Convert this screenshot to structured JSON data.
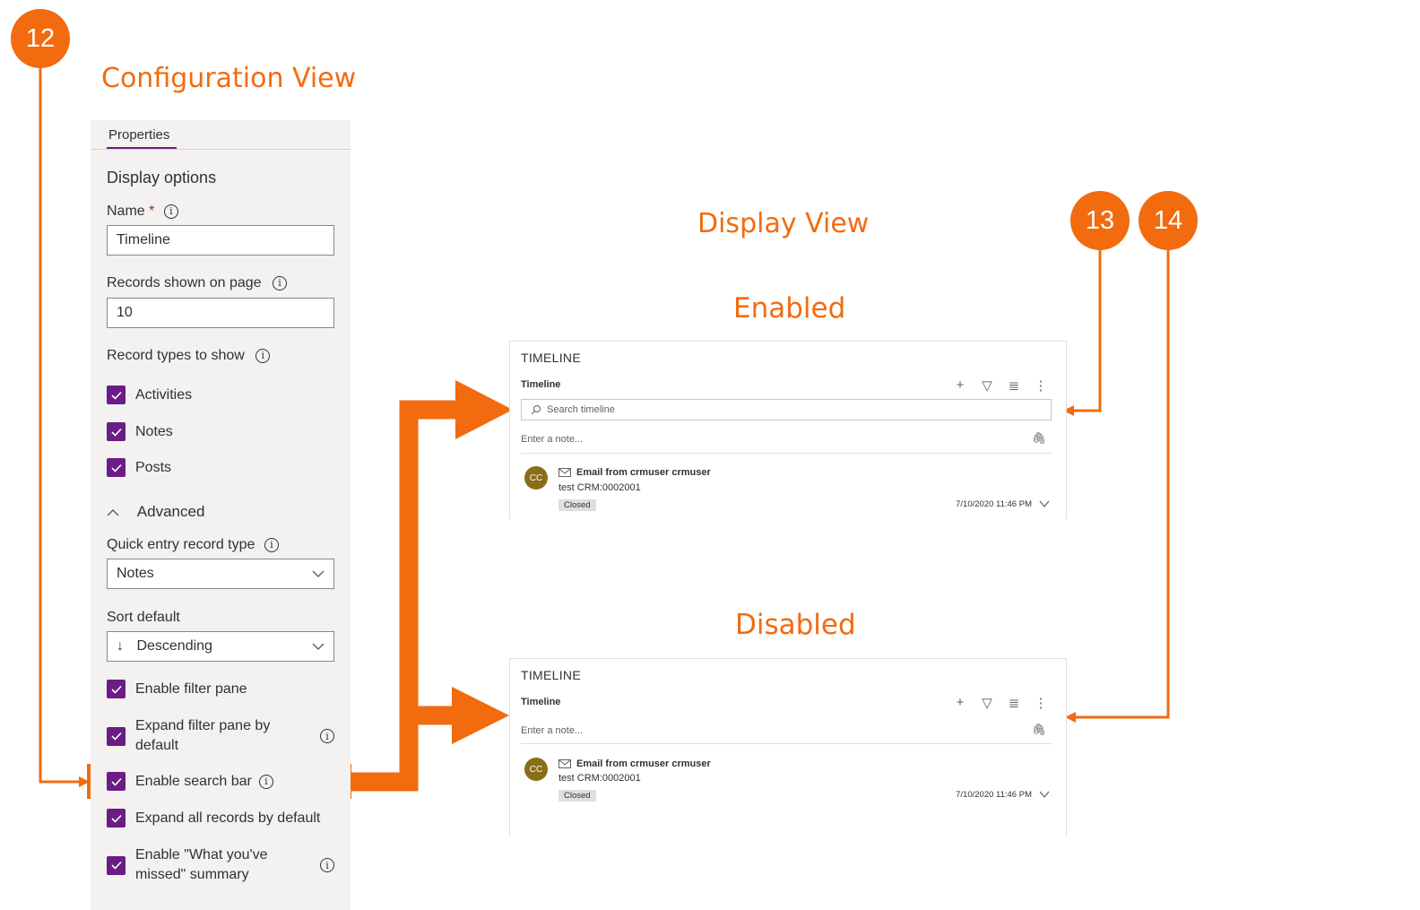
{
  "annotations": {
    "badge_12": "12",
    "badge_13": "13",
    "badge_14": "14",
    "configuration_title": "Configuration View",
    "display_title": "Display View",
    "enabled_title": "Enabled",
    "disabled_title": "Disabled",
    "accent_color": "#f26b0f"
  },
  "properties_panel": {
    "tab": "Properties",
    "section_display": "Display options",
    "name_label": "Name",
    "name_required": "*",
    "name_value": "Timeline",
    "records_label": "Records shown on page",
    "records_value": "10",
    "record_types_label": "Record types to show",
    "record_types": [
      {
        "label": "Activities",
        "checked": true
      },
      {
        "label": "Notes",
        "checked": true
      },
      {
        "label": "Posts",
        "checked": true
      }
    ],
    "advanced_label": "Advanced",
    "quick_entry_label": "Quick entry record type",
    "quick_entry_value": "Notes",
    "sort_label": "Sort default",
    "sort_value": "Descending",
    "options": [
      {
        "label": "Enable filter pane",
        "checked": true
      },
      {
        "label": "Expand filter pane by default",
        "checked": true
      },
      {
        "label": "Enable search bar",
        "checked": true
      },
      {
        "label": "Expand all records by default",
        "checked": true
      },
      {
        "label": "Enable \"What you've missed\" summary",
        "checked": true
      }
    ],
    "checkbox_color": "#6b1d85",
    "info_glyph": "i"
  },
  "timeline_enabled": {
    "header": "TIMELINE",
    "subtitle": "Timeline",
    "search_placeholder": "Search timeline",
    "note_placeholder": "Enter a note...",
    "activity": {
      "avatar": "CC",
      "title": "Email from crmuser crmuser",
      "subject": "test CRM:0002001",
      "status": "Closed",
      "timestamp": "7/10/2020 11:46 PM"
    }
  },
  "timeline_disabled": {
    "header": "TIMELINE",
    "subtitle": "Timeline",
    "note_placeholder": "Enter a note...",
    "activity": {
      "avatar": "CC",
      "title": "Email from crmuser crmuser",
      "subject": "test CRM:0002001",
      "status": "Closed",
      "timestamp": "7/10/2020 11:46 PM"
    }
  },
  "toolbar_icons": [
    "add-icon",
    "filter-icon",
    "list-icon",
    "more-icon"
  ]
}
